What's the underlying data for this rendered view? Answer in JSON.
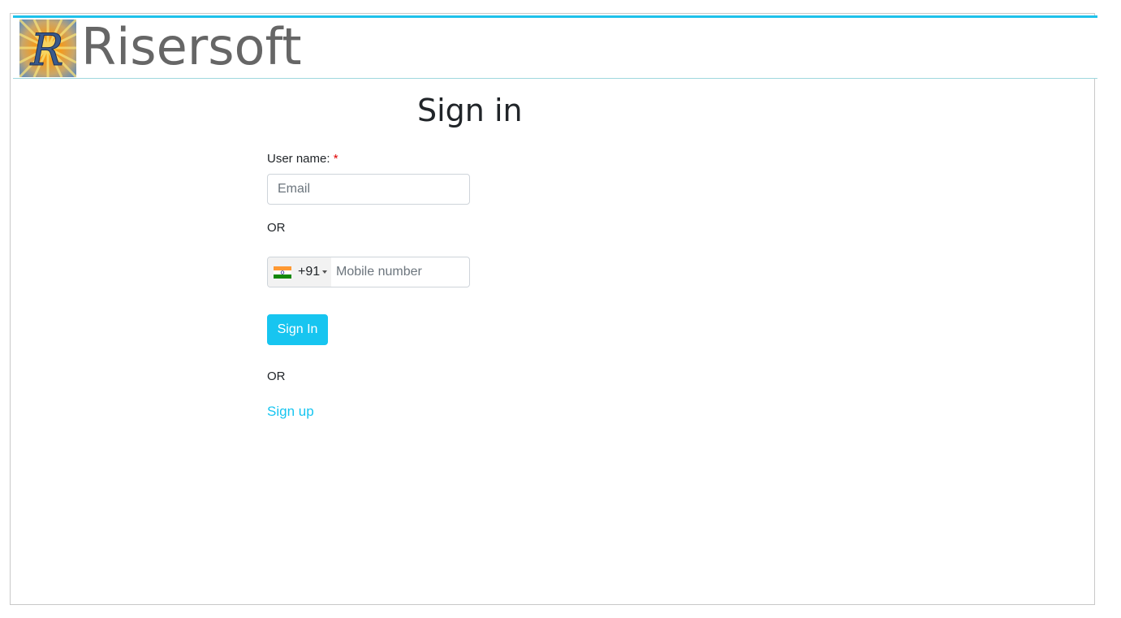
{
  "header": {
    "brand": "Risersoft",
    "logo_letter": "R",
    "accent_color": "#1fc1ea"
  },
  "form": {
    "title": "Sign in",
    "username_label": "User name:",
    "required_mark": "*",
    "email_placeholder": "Email",
    "or_1": "OR",
    "country_flag": "india-flag-icon",
    "country_code": "+91",
    "mobile_placeholder": "Mobile number",
    "signin_label": "Sign In",
    "or_2": "OR",
    "signup_label": "Sign up",
    "button_color": "#17c5f0"
  }
}
